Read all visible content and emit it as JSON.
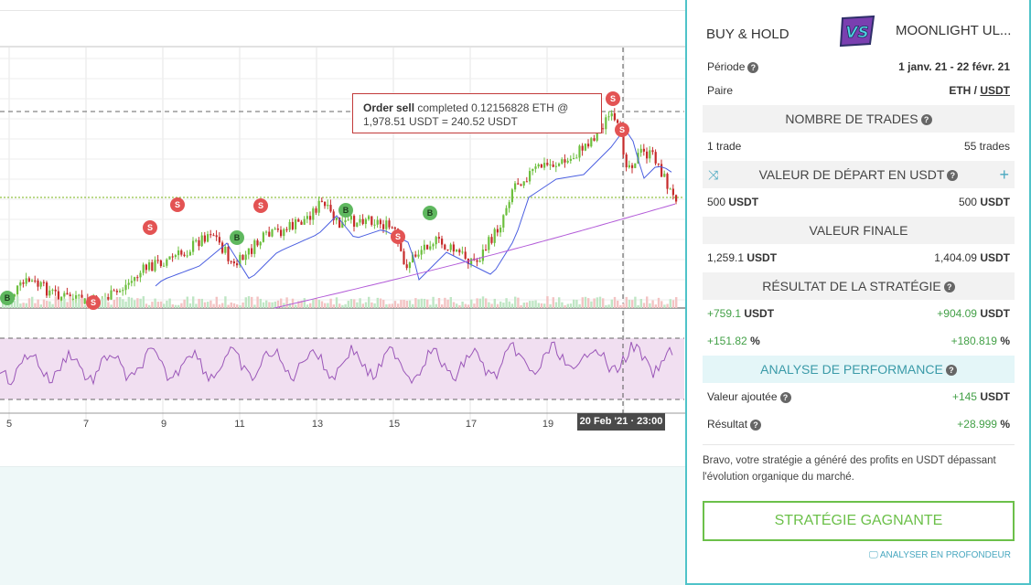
{
  "chart": {
    "tooltip": {
      "action": "Order sell",
      "text1": "completed 0.12156828 ETH @",
      "text2": "1,978.51 USDT = 240.52 USDT"
    },
    "date_badge": "20 Feb '21 · 23:00",
    "x_labels": [
      "5",
      "7",
      "9",
      "11",
      "13",
      "15",
      "17",
      "19"
    ],
    "signals": [
      {
        "type": "S",
        "label": "S"
      },
      {
        "type": "S",
        "label": "S"
      },
      {
        "type": "S",
        "label": "S"
      },
      {
        "type": "S",
        "label": "S"
      },
      {
        "type": "S",
        "label": "S"
      },
      {
        "type": "S",
        "label": "S"
      },
      {
        "type": "S",
        "label": "S"
      },
      {
        "type": "B",
        "label": "B"
      },
      {
        "type": "B",
        "label": "B"
      },
      {
        "type": "B",
        "label": "B"
      },
      {
        "type": "B",
        "label": "B"
      }
    ],
    "colors": {
      "up": "#6cbf3d",
      "down": "#c62b2b",
      "ma_blue": "#4a5ee0",
      "ma_purple": "#b25ad8",
      "rsi": "#9a56b8",
      "rsi_band": "#f1dff1"
    }
  },
  "panel": {
    "left_title": "BUY & HOLD",
    "vs": "VS",
    "right_title": "MOONLIGHT UL...",
    "periode_label": "Période",
    "periode_value": "1 janv. 21 - 22 févr. 21",
    "paire_label": "Paire",
    "paire_base": "ETH",
    "paire_sep": " / ",
    "paire_quote": "USDT",
    "trades_header": "NOMBRE DE TRADES",
    "trades_left": "1 trade",
    "trades_right": "55 trades",
    "start_header": "VALEUR DE DÉPART EN USDT",
    "start_left_num": "500",
    "start_left_unit": "USDT",
    "start_right_num": "500",
    "start_right_unit": "USDT",
    "final_header": "VALEUR FINALE",
    "final_left_num": "1,259.1",
    "final_left_unit": "USDT",
    "final_right_num": "1,404.09",
    "final_right_unit": "USDT",
    "result_header": "RÉSULTAT DE LA STRATÉGIE",
    "result_left_num": "+759.1",
    "result_left_unit": "USDT",
    "result_right_num": "+904.09",
    "result_right_unit": "USDT",
    "pct_left_num": "+151.82",
    "pct_left_unit": "%",
    "pct_right_num": "+180.819",
    "pct_right_unit": "%",
    "perf_header": "ANALYSE DE PERFORMANCE",
    "added_label": "Valeur ajoutée",
    "added_num": "+145",
    "added_unit": "USDT",
    "res_label": "Résultat",
    "res_num": "+28.999",
    "res_unit": "%",
    "summary": "Bravo, votre stratégie a généré des profits en USDT dépassant l'évolution organique du marché.",
    "win_button": "STRATÉGIE GAGNANTE",
    "deep_link": "ANALYSER EN PROFONDEUR",
    "q_glyph": "?",
    "accent": "#4fc3c9",
    "win_color": "#6cc04a"
  }
}
